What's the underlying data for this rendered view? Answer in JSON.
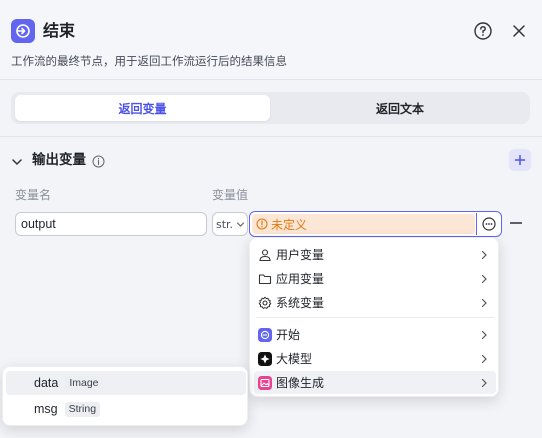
{
  "header": {
    "title": "结束",
    "description": "工作流的最终节点，用于返回工作流运行后的结果信息",
    "node_icon": "end-node-icon",
    "accent": "#6165ef"
  },
  "tabs": [
    {
      "label": "返回变量",
      "active": true
    },
    {
      "label": "返回文本",
      "active": false
    }
  ],
  "output": {
    "section_title": "输出变量",
    "col_name": "变量名",
    "col_value": "变量值",
    "row": {
      "name": "output",
      "type": "str.",
      "value_status": "未定义"
    }
  },
  "menu": {
    "items": [
      {
        "label": "用户变量",
        "icon": "user-icon"
      },
      {
        "label": "应用变量",
        "icon": "folder-icon"
      },
      {
        "label": "系统变量",
        "icon": "gear-icon"
      },
      {
        "label": "开始",
        "icon": "start-node-icon",
        "color": "#6165ef"
      },
      {
        "label": "大模型",
        "icon": "llm-node-icon",
        "color": "#111111"
      },
      {
        "label": "图像生成",
        "icon": "image-gen-node-icon",
        "color": "#e84393"
      }
    ]
  },
  "submenu": {
    "items": [
      {
        "name": "data",
        "type": "Image"
      },
      {
        "name": "msg",
        "type": "String"
      }
    ]
  }
}
